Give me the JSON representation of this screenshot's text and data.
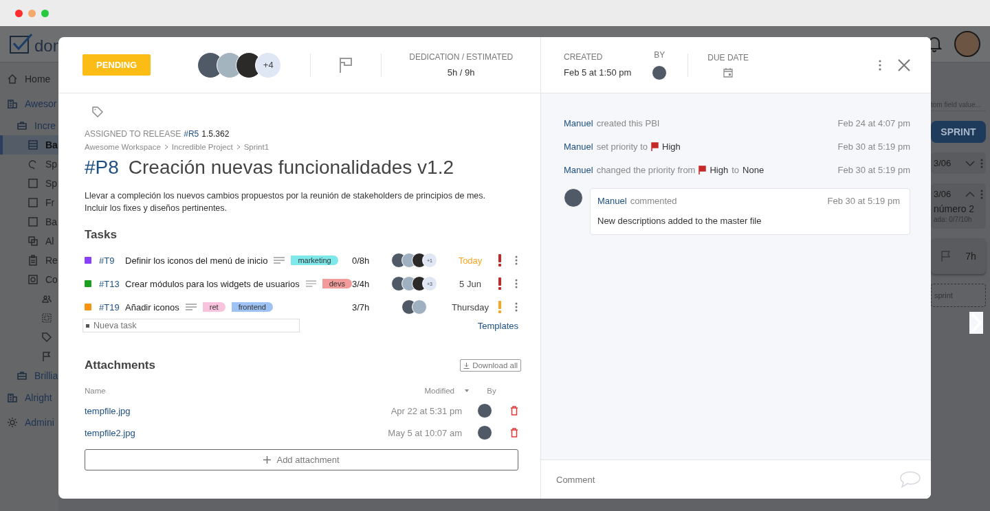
{
  "app": {
    "logo_text": "don",
    "sidebar": [
      {
        "label": "Home",
        "kind": "home",
        "selected": false
      },
      {
        "label": "Awesor",
        "kind": "building",
        "selected": false,
        "children": [
          {
            "label": "Incre",
            "kind": "briefcase",
            "selected": false,
            "children": [
              {
                "label": "Ba",
                "kind": "table",
                "selected": true
              },
              {
                "label": "Sp",
                "kind": "sprint",
                "selected": false
              },
              {
                "label": "Sp",
                "kind": "square",
                "selected": false
              },
              {
                "label": "Fr",
                "kind": "square",
                "selected": false
              },
              {
                "label": "Ba",
                "kind": "square",
                "selected": false
              },
              {
                "label": "Al",
                "kind": "copy",
                "selected": false
              },
              {
                "label": "Re",
                "kind": "clipboard",
                "selected": false
              },
              {
                "label": "Co",
                "kind": "gear-box",
                "selected": false,
                "children": [
                  {
                    "kind": "people",
                    "selected": false
                  },
                  {
                    "kind": "select",
                    "selected": false
                  },
                  {
                    "kind": "tag",
                    "selected": false
                  },
                  {
                    "kind": "flag",
                    "selected": false
                  }
                ]
              }
            ]
          },
          {
            "label": "Brillia",
            "kind": "briefcase",
            "selected": false
          }
        ]
      },
      {
        "label": "Alright",
        "kind": "building",
        "selected": false
      },
      {
        "label": "Admini",
        "kind": "gear",
        "selected": false
      }
    ],
    "board": {
      "search_placeholder": "tom field value...",
      "sprint_button": "SPRINT",
      "cards": [
        {
          "date": "3/06",
          "expanded": false
        },
        {
          "date": "3/06",
          "expanded": true,
          "title": "número 2",
          "meta": "ada: 0/7/10h"
        }
      ],
      "hours": "7h",
      "new_sprint": "sprint"
    }
  },
  "modal": {
    "status": "PENDING",
    "assignees": {
      "more": "+4"
    },
    "dedication": {
      "label": "DEDICATION / ESTIMATED",
      "value": "5h / 9h"
    },
    "created": {
      "label": "CREATED",
      "value": "Feb 5 at 1:50 pm"
    },
    "by_label": "BY",
    "due_label": "DUE DATE",
    "release": {
      "label": "ASSIGNED TO RELEASE",
      "id": "#R5",
      "version": "1.5.362"
    },
    "breadcrumb": [
      "Awesome Workspace",
      "Incredible Project",
      "Sprint1"
    ],
    "id": "#P8",
    "title": "Creación nuevas funcionalidades v1.2",
    "description": "Llevar a compleción los nuevos cambios propuestos por la reunión de stakeholders de principios de mes. Incluir los fixes y diseños pertinentes.",
    "tasks_heading": "Tasks",
    "tasks": [
      {
        "color": "#8a3ffc",
        "id": "#T9",
        "title": "Definir los iconos del menú de inicio",
        "tags": [
          {
            "label": "marketing",
            "color": "#7ee8ea"
          }
        ],
        "hours": "0/8h",
        "more": "+1",
        "due": "Today",
        "due_today": true,
        "urgent": true
      },
      {
        "color": "#1aa01a",
        "id": "#T13",
        "title": "Crear módulos para los widgets de usuarios",
        "tags": [
          {
            "label": "devs",
            "color": "#f29b9b"
          }
        ],
        "hours": "3/4h",
        "more": "+3",
        "due": "5 Jun",
        "due_today": false,
        "urgent": true
      },
      {
        "color": "#f7930e",
        "id": "#T19",
        "title": "Añadir iconos",
        "tags": [
          {
            "label": "ret",
            "color": "#f8c3dd"
          },
          {
            "label": "frontend",
            "color": "#9fc2f5"
          }
        ],
        "hours": "3/7h",
        "due": "Thursday",
        "due_today": false,
        "urgent": false
      }
    ],
    "new_task_placeholder": "Nueva task",
    "templates": "Templates",
    "attachments_heading": "Attachments",
    "download_all": "Download all",
    "attachment_columns": {
      "name": "Name",
      "modified": "Modified",
      "by": "By"
    },
    "attachments": [
      {
        "name": "tempfile.jpg",
        "modified": "Apr 22 at 5:31 pm"
      },
      {
        "name": "tempfile2.jpg",
        "modified": "May 5 at 10:07 am"
      }
    ],
    "add_attachment": "Add attachment",
    "activity": [
      {
        "user": "Manuel",
        "parts": [
          {
            "kind": "text",
            "text": "created this PBI"
          }
        ],
        "date": "Feb 24 at 4:07 pm"
      },
      {
        "user": "Manuel",
        "parts": [
          {
            "kind": "text",
            "text": "set priority to"
          },
          {
            "kind": "flag"
          },
          {
            "kind": "value",
            "text": "High"
          }
        ],
        "date": "Feb 30 at 5:19 pm"
      },
      {
        "user": "Manuel",
        "parts": [
          {
            "kind": "text",
            "text": "changed the priority from"
          },
          {
            "kind": "flag"
          },
          {
            "kind": "value",
            "text": "High"
          },
          {
            "kind": "text",
            "text": "to"
          },
          {
            "kind": "value",
            "text": "None"
          }
        ],
        "date": "Feb 30 at 5:19 pm"
      }
    ],
    "comment": {
      "user": "Manuel",
      "action": "commented",
      "date": "Feb 30 at 5:19 pm",
      "body": "New descriptions added to the master file"
    },
    "comment_placeholder": "Comment"
  }
}
